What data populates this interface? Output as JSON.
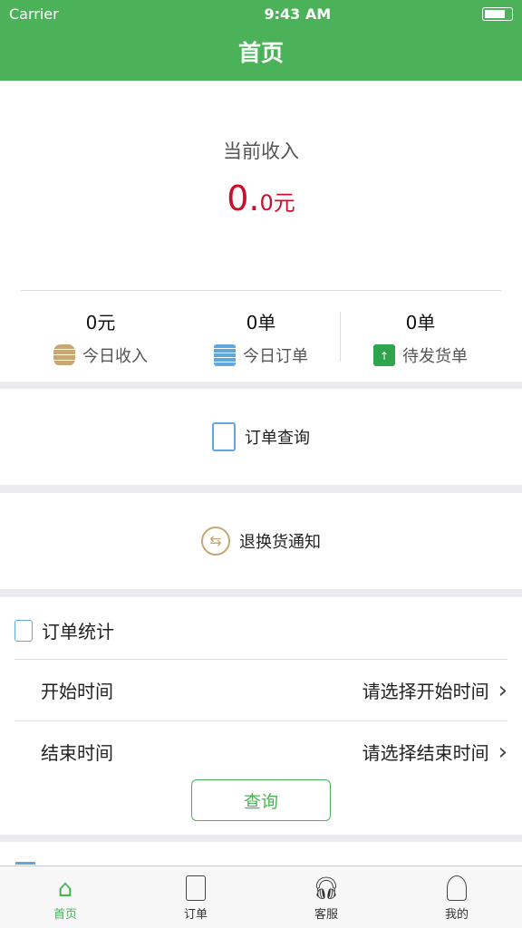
{
  "status_bar": {
    "carrier": "Carrier",
    "time": "9:43 AM"
  },
  "header": {
    "title": "首页"
  },
  "income": {
    "label": "当前收入",
    "value_int": "0.",
    "value_dec": "0元",
    "stats": [
      {
        "value": "0元",
        "label": "今日收入",
        "icon": "coins-icon"
      },
      {
        "value": "0单",
        "label": "今日订单",
        "icon": "document-icon"
      },
      {
        "value": "0单",
        "label": "待发货单",
        "icon": "package-icon"
      }
    ]
  },
  "order_query": {
    "label": "订单查询"
  },
  "return_notice": {
    "label": "退换货通知"
  },
  "order_stats": {
    "title": "订单统计",
    "start_label": "开始时间",
    "start_placeholder": "请选择开始时间",
    "end_label": "结束时间",
    "end_placeholder": "请选择结束时间",
    "query_button": "查询"
  },
  "tabbar": [
    {
      "label": "首页",
      "active": true
    },
    {
      "label": "订单"
    },
    {
      "label": "客服"
    },
    {
      "label": "我的"
    }
  ],
  "colors": {
    "brand": "#4cb25a",
    "income": "#c8102e"
  }
}
